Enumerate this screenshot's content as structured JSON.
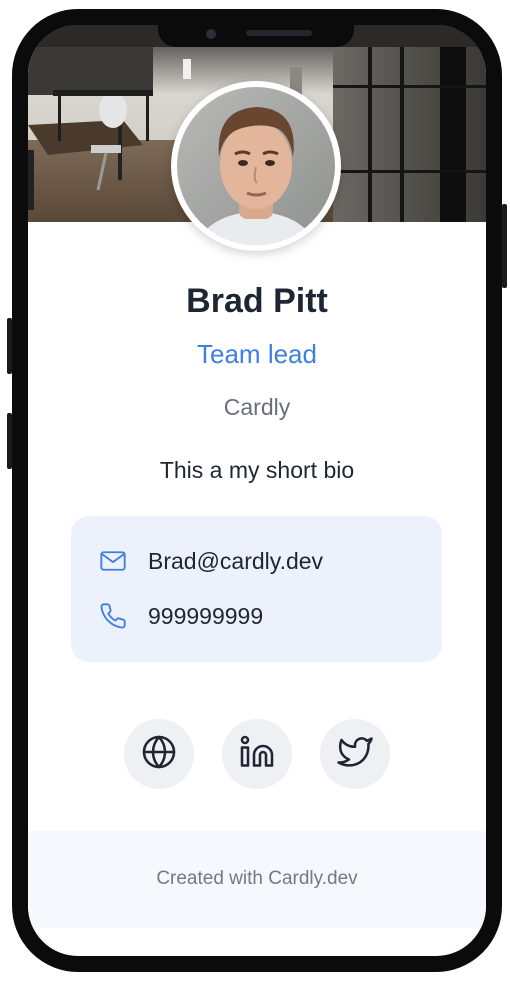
{
  "profile": {
    "name": "Brad Pitt",
    "role": "Team lead",
    "company": "Cardly",
    "bio": "This a my short bio"
  },
  "contact": {
    "email": "Brad@cardly.dev",
    "email_icon": "mail-icon",
    "phone": "999999999",
    "phone_icon": "phone-icon"
  },
  "social_links": [
    {
      "icon": "globe-icon"
    },
    {
      "icon": "linkedin-icon"
    },
    {
      "icon": "twitter-icon"
    }
  ],
  "footer": {
    "text": "Created with Cardly.dev"
  },
  "colors": {
    "accent": "#3f7fe0",
    "name_text": "#1f2633",
    "muted_text": "#6b6f78",
    "contact_bg": "#edf1fc",
    "footer_bg": "#f5f8fd",
    "social_bg": "#eef0f3",
    "phone_frame": "#0b0b0b"
  }
}
